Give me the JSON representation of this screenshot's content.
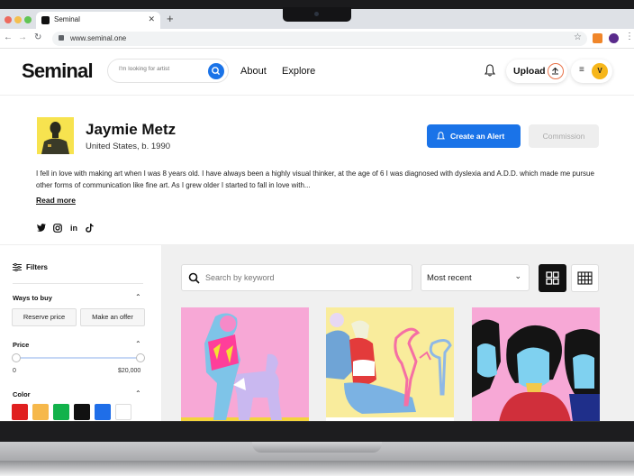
{
  "browser": {
    "tab_title": "Seminal",
    "url": "www.seminal.one"
  },
  "header": {
    "logo": "Seminal",
    "search_placeholder": "I'm looking for artist",
    "nav": [
      "About",
      "Explore"
    ],
    "upload_label": "Upload",
    "user_initial": "V"
  },
  "profile": {
    "name": "Jaymie Metz",
    "location": "United States, b. 1990",
    "create_alert_label": "Create an Alert",
    "commission_label": "Commission",
    "bio": "I fell in love with making art when I was 8 years old. I have always been a highly visual thinker, at the age of 6 I was diagnosed with dyslexia and A.D.D. which made me pursue other forms of communication like fine art. As I grew older I started to fall in love with...",
    "read_more": "Read more",
    "social": [
      "twitter-icon",
      "instagram-icon",
      "linkedin-icon",
      "tiktok-icon"
    ]
  },
  "filters": {
    "title": "Filters",
    "ways_to_buy": {
      "title": "Ways to buy",
      "options": [
        "Reserve price",
        "Make an offer"
      ]
    },
    "price": {
      "title": "Price",
      "min_label": "0",
      "max_label": "$20,000"
    },
    "color": {
      "title": "Color",
      "swatches": [
        "#e02020",
        "#f6b84b",
        "#12b24b",
        "#111111",
        "#1f6ee8",
        "#ffffff"
      ]
    }
  },
  "gallery": {
    "search_placeholder": "Search by keyword",
    "sort_label": "Most recent",
    "view_modes": [
      "large-grid",
      "small-grid"
    ],
    "active_view": "large-grid"
  },
  "colors": {
    "accent": "#1a73e8",
    "upload_ring": "#e8734a",
    "avatar_bg": "#f6b61a"
  }
}
